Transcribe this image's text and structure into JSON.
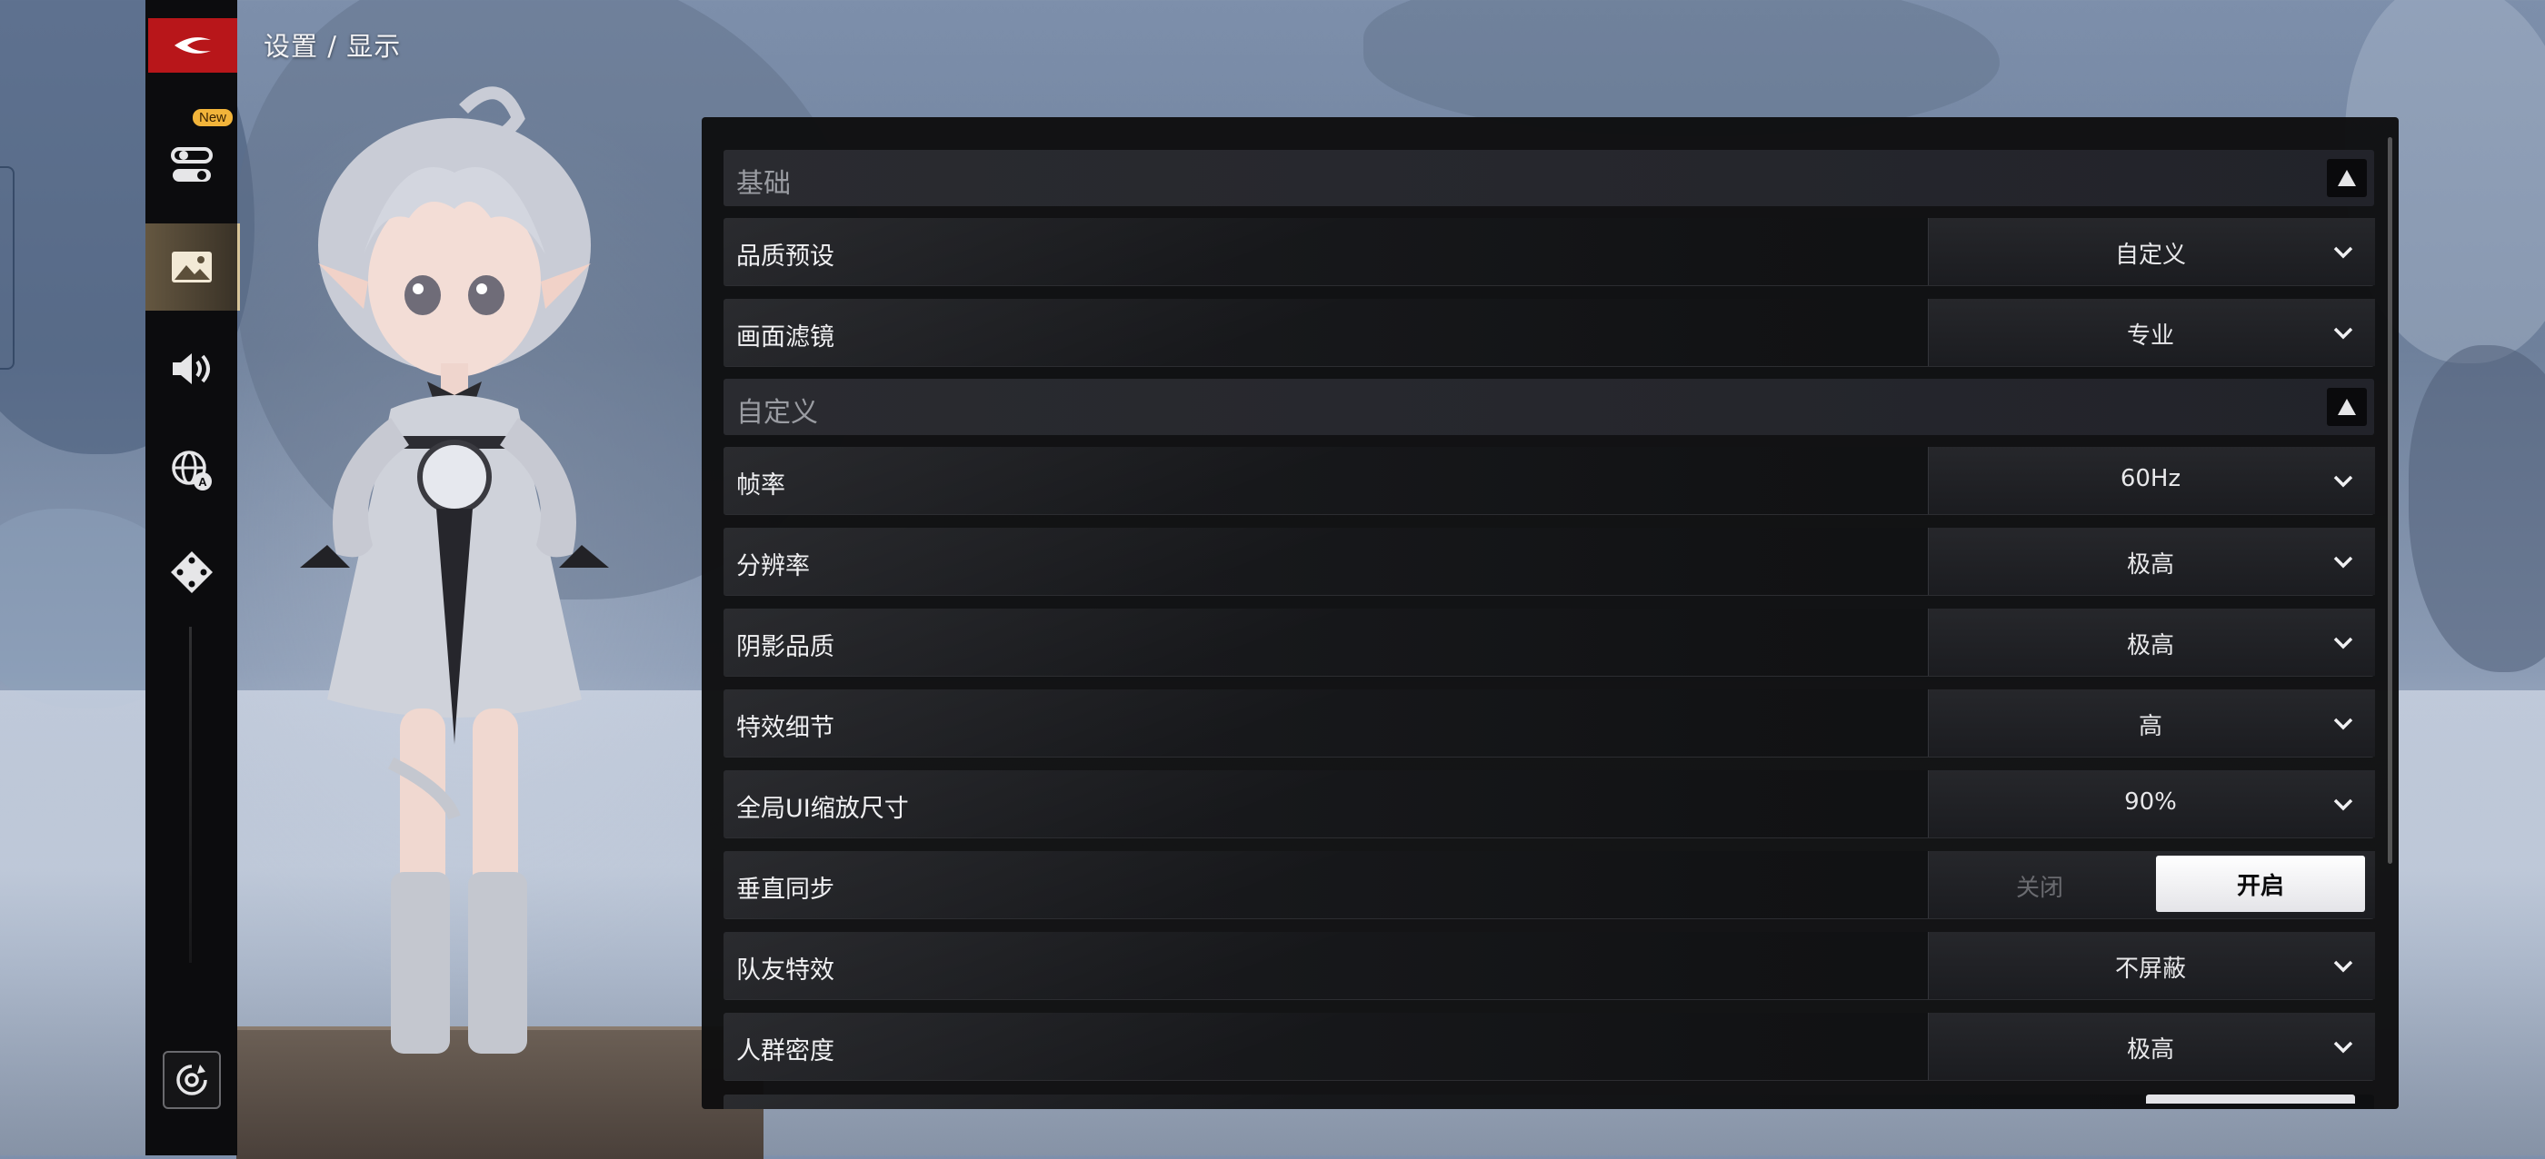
{
  "breadcrumb": "设置 / 显示",
  "sidebar": {
    "new_badge": "New",
    "items": [
      {
        "icon": "toggles-icon"
      },
      {
        "icon": "image-icon",
        "active": true
      },
      {
        "icon": "speaker-icon"
      },
      {
        "icon": "globe-language-icon"
      },
      {
        "icon": "gamepad-dpad-icon"
      }
    ]
  },
  "sections": {
    "basic": {
      "title": "基础"
    },
    "custom": {
      "title": "自定义"
    }
  },
  "rows": {
    "quality_preset": {
      "label": "品质预设",
      "value": "自定义"
    },
    "screen_filter": {
      "label": "画面滤镜",
      "value": "专业"
    },
    "frame_rate": {
      "label": "帧率",
      "value": "60Hz"
    },
    "resolution": {
      "label": "分辨率",
      "value": "极高"
    },
    "shadow_quality": {
      "label": "阴影品质",
      "value": "极高"
    },
    "effects_detail": {
      "label": "特效细节",
      "value": "高"
    },
    "ui_scale": {
      "label": "全局UI缩放尺寸",
      "value": "90%"
    },
    "vsync": {
      "label": "垂直同步",
      "off_label": "关闭",
      "on_label": "开启",
      "enabled": true
    },
    "teammate_effects": {
      "label": "队友特效",
      "value": "不屏蔽"
    },
    "crowd_density": {
      "label": "人群密度",
      "value": "极高"
    }
  },
  "colors": {
    "accent_red": "#b8161a",
    "active_nav": "#d8c59a",
    "panel_bg": "#0e0e10"
  }
}
